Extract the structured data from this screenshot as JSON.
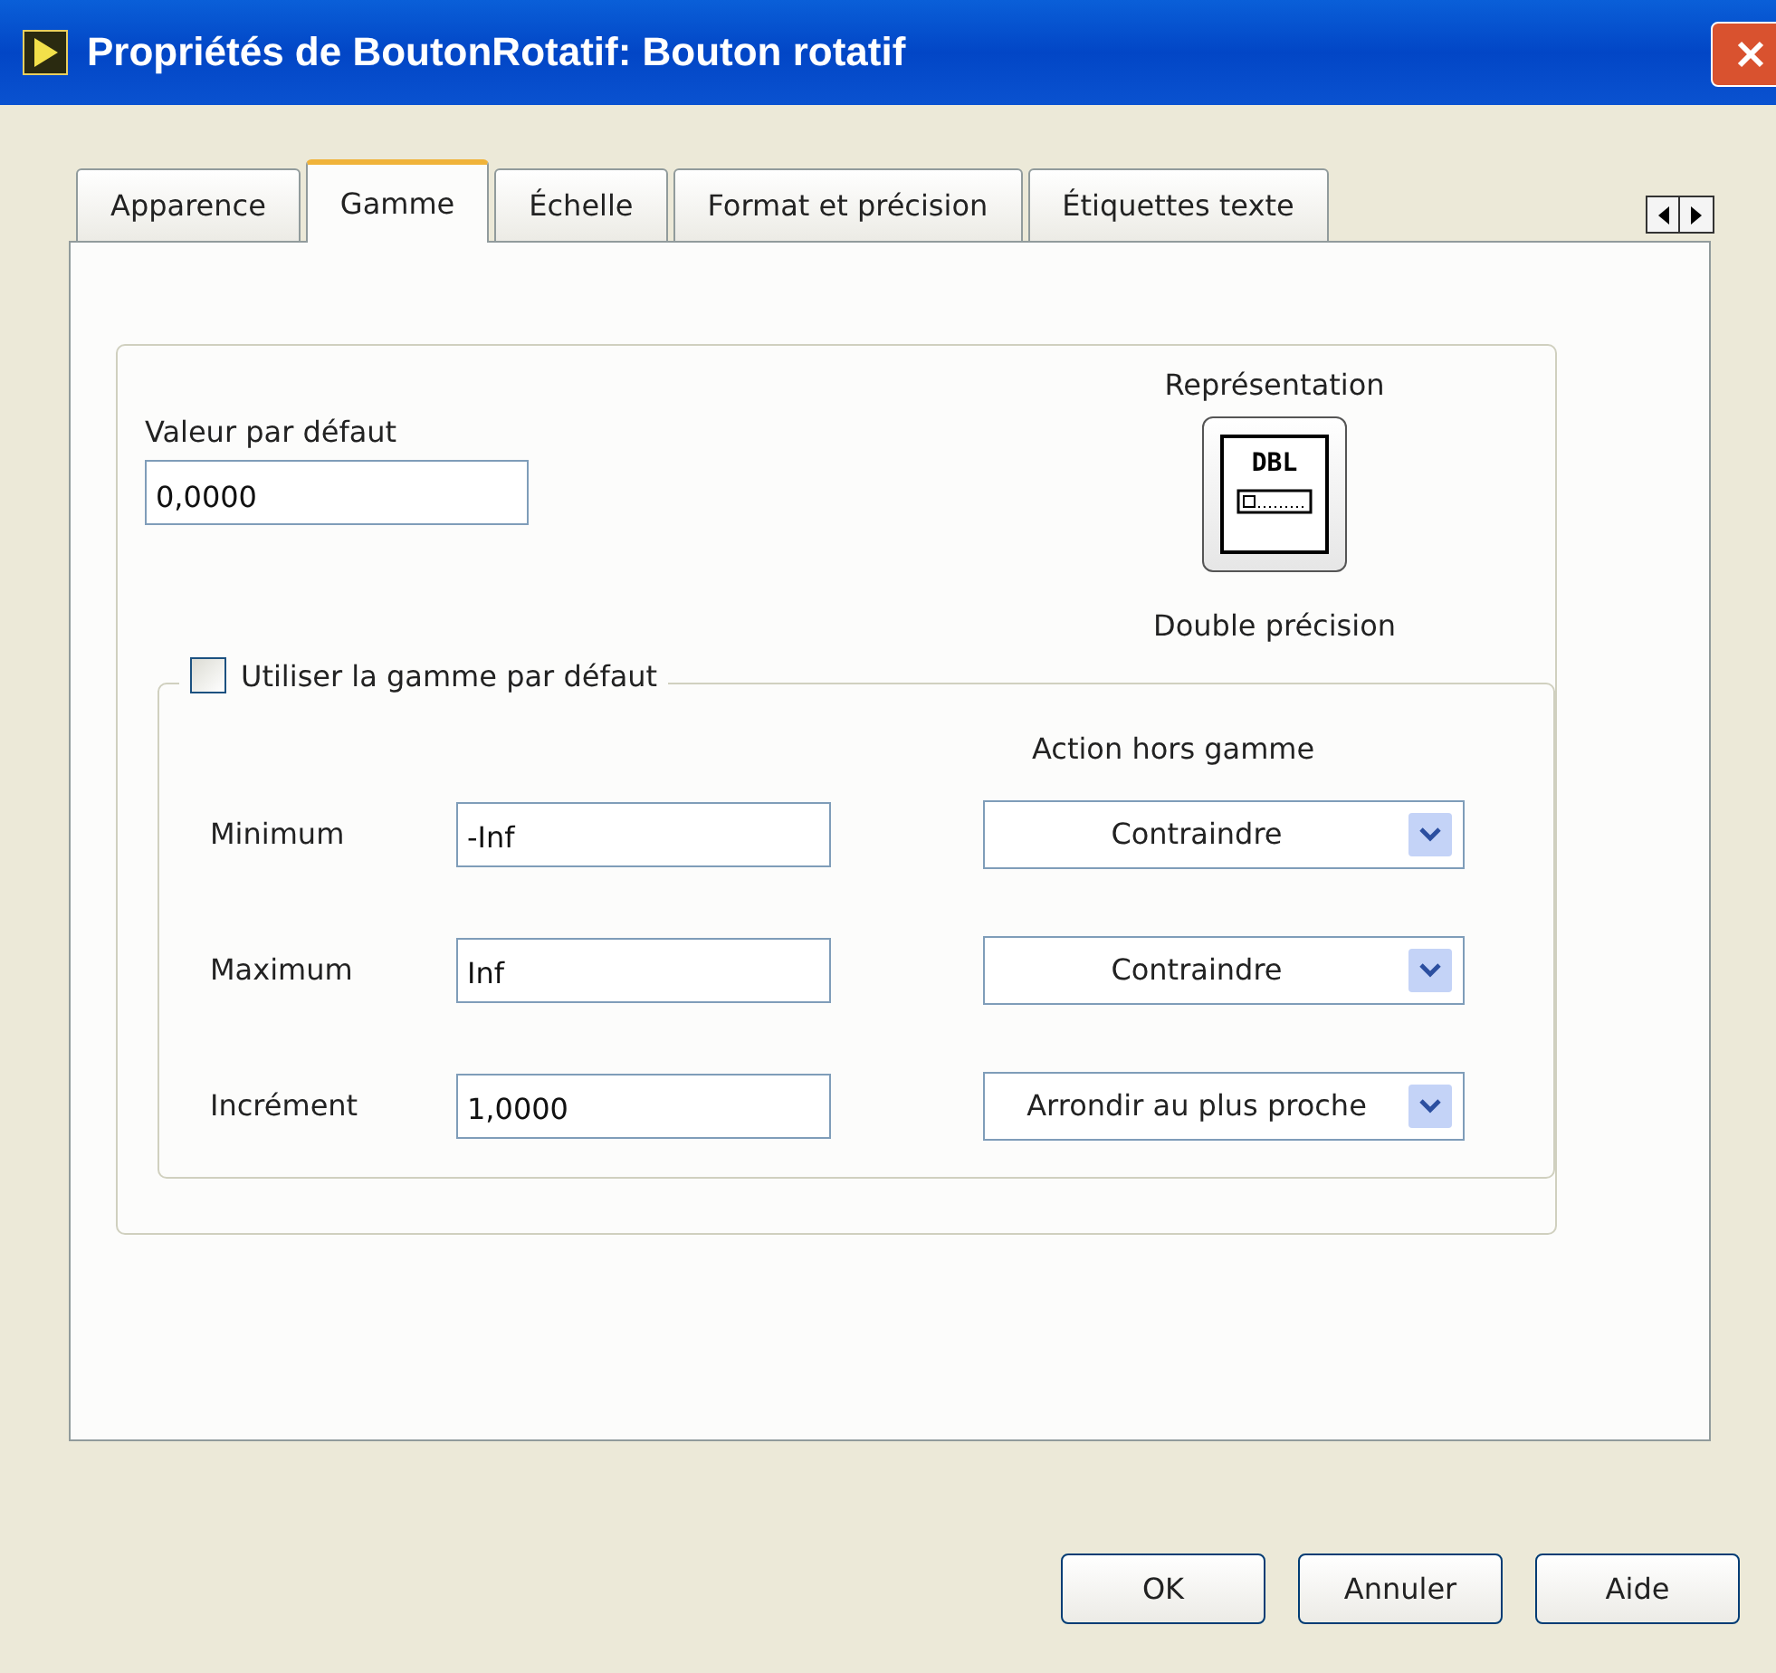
{
  "window": {
    "title": "Propriétés de BoutonRotatif: Bouton rotatif"
  },
  "tabs": [
    {
      "label": "Apparence",
      "selected": false
    },
    {
      "label": "Gamme",
      "selected": true
    },
    {
      "label": "Échelle",
      "selected": false
    },
    {
      "label": "Format et précision",
      "selected": false
    },
    {
      "label": "Étiquettes texte",
      "selected": false
    }
  ],
  "default_value": {
    "label": "Valeur par défaut",
    "value": "0,0000"
  },
  "representation": {
    "label": "Représentation",
    "icon_text": "DBL",
    "caption": "Double précision"
  },
  "range": {
    "use_default": {
      "label": "Utiliser la gamme par défaut",
      "checked": false
    },
    "action_heading": "Action hors gamme",
    "rows": [
      {
        "label": "Minimum",
        "value": "-Inf",
        "action": "Contraindre"
      },
      {
        "label": "Maximum",
        "value": "Inf",
        "action": "Contraindre"
      },
      {
        "label": "Incrément",
        "value": "1,0000",
        "action": "Arrondir au plus proche"
      }
    ]
  },
  "buttons": [
    "OK",
    "Annuler",
    "Aide"
  ]
}
